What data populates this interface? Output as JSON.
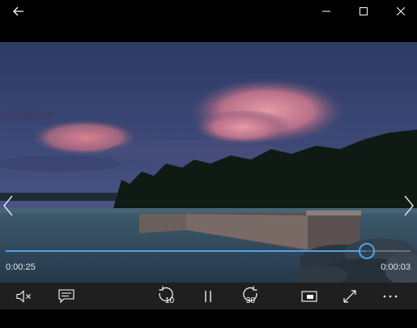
{
  "window": {
    "back_icon": "back-arrow-icon",
    "minimize_icon": "minimize-icon",
    "maximize_icon": "maximize-icon",
    "close_icon": "close-icon"
  },
  "video": {
    "prev_icon": "chevron-left-icon",
    "next_icon": "chevron-right-icon"
  },
  "playback": {
    "elapsed": "0:00:25",
    "remaining": "0:00:03",
    "progress": 0.89,
    "accent": "#4ea3e6"
  },
  "controls": {
    "mute_icon": "volume-muted-icon",
    "subtitles_icon": "subtitles-icon",
    "skip_back_label": "10",
    "pause_icon": "pause-icon",
    "skip_forward_label": "30",
    "miniview_icon": "mini-view-icon",
    "fullscreen_icon": "fullscreen-icon",
    "more_icon": "more-icon"
  },
  "colors": {
    "controls_bg": "#1f1f1f",
    "window_bg": "#000000"
  }
}
